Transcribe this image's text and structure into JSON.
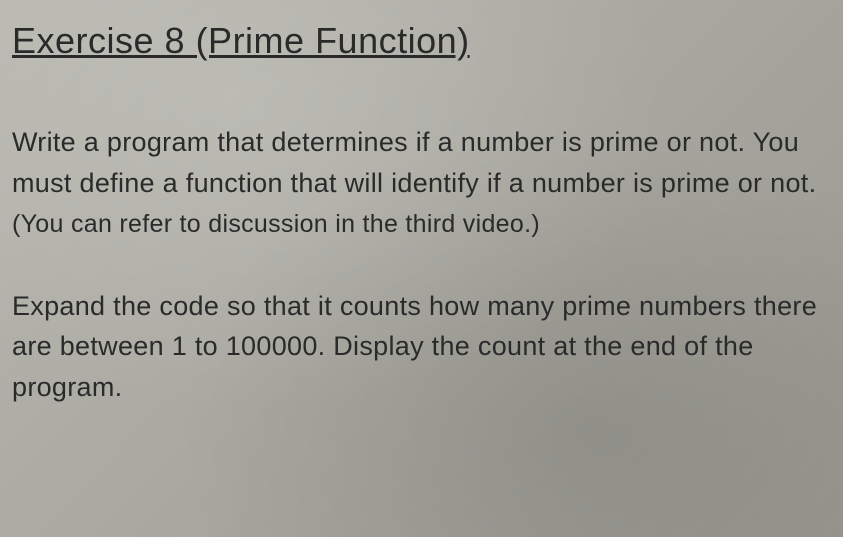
{
  "heading": "Exercise 8 (Prime Function)",
  "paragraph1_part1": "Write a program that determines if a number is prime or not. You must define a function that will identify if a number is prime or not. ",
  "paragraph1_hint": "(You can refer to discussion in the third video.)",
  "paragraph2": "Expand the code so that it counts how many prime numbers there are between 1 to 100000. Display the count at the end of the program."
}
